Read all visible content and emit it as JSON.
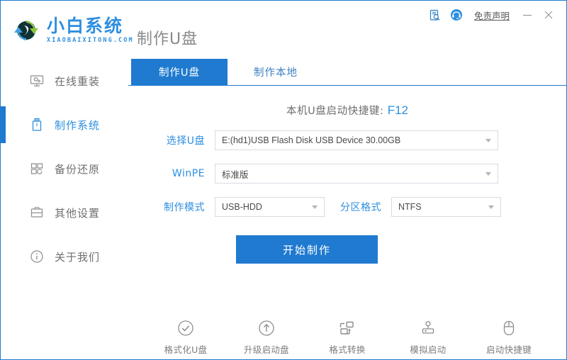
{
  "window": {
    "page_title": "制作U盘",
    "logo_cn": "小白系统",
    "logo_en": "XIAOBAIXITONG.COM",
    "accent_color": "#1f7ad0",
    "logo_color": "#2d8fe0",
    "controls": {
      "doc_search_icon": "document-search-icon",
      "support_icon": "customer-service-icon",
      "disclaimer": "免责声明",
      "minimize": "—",
      "close": "✕"
    }
  },
  "sidebar": {
    "items": [
      {
        "label": "在线重装",
        "icon": "monitor-icon",
        "active": false
      },
      {
        "label": "制作系统",
        "icon": "usb-drive-icon",
        "active": true
      },
      {
        "label": "备份还原",
        "icon": "grid-restore-icon",
        "active": false
      },
      {
        "label": "其他设置",
        "icon": "toolbox-icon",
        "active": false
      },
      {
        "label": "关于我们",
        "icon": "info-circle-icon",
        "active": false
      }
    ]
  },
  "main": {
    "tabs": [
      {
        "label": "制作U盘",
        "active": true
      },
      {
        "label": "制作本地",
        "active": false
      }
    ],
    "hotkey": {
      "prefix": "本机U盘启动快捷键:",
      "value": "F12"
    },
    "form": {
      "usb": {
        "label": "选择U盘",
        "value": "E:(hd1)USB Flash Disk USB Device 30.00GB"
      },
      "winpe": {
        "label": "WinPE",
        "value": "标准版"
      },
      "mode": {
        "label": "制作模式",
        "value": "USB-HDD"
      },
      "partition": {
        "label": "分区格式",
        "value": "NTFS"
      }
    },
    "start_button": "开始制作"
  },
  "bottom_toolbar": {
    "items": [
      {
        "label": "格式化U盘",
        "icon": "check-circle-icon"
      },
      {
        "label": "升级启动盘",
        "icon": "arrow-up-circle-icon"
      },
      {
        "label": "格式转换",
        "icon": "format-convert-icon"
      },
      {
        "label": "模拟启动",
        "icon": "joystick-icon"
      },
      {
        "label": "启动快捷键",
        "icon": "mouse-icon"
      }
    ]
  }
}
